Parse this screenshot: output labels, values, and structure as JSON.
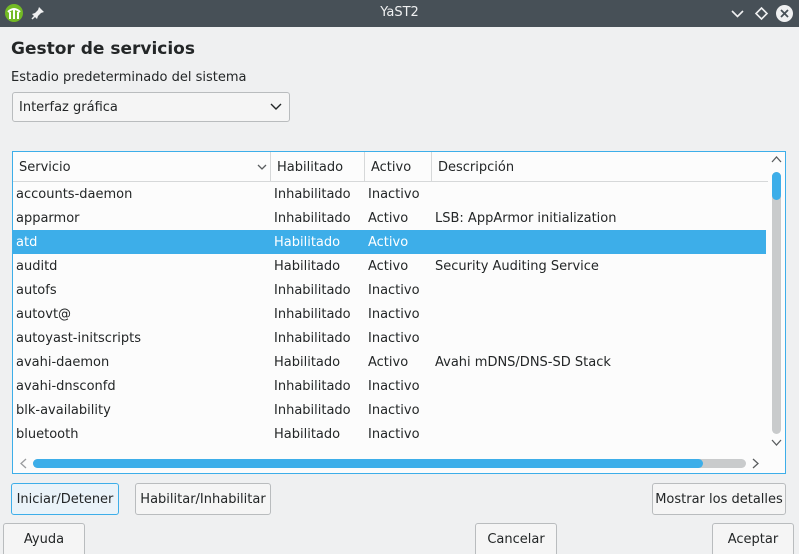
{
  "window": {
    "title": "YaST2"
  },
  "page": {
    "heading": "Gestor de servicios",
    "default_target_label": "Estadio predeterminado del sistema",
    "default_target_value": "Interfaz gráfica"
  },
  "table": {
    "columns": [
      "Servicio",
      "Habilitado",
      "Activo",
      "Descripción"
    ],
    "rows": [
      {
        "name": "accounts-daemon",
        "enabled": "Inhabilitado",
        "active": "Inactivo",
        "description": ""
      },
      {
        "name": "apparmor",
        "enabled": "Inhabilitado",
        "active": "Activo",
        "description": "LSB: AppArmor initialization"
      },
      {
        "name": "atd",
        "enabled": "Habilitado",
        "active": "Activo",
        "description": "",
        "selected": true
      },
      {
        "name": "auditd",
        "enabled": "Habilitado",
        "active": "Activo",
        "description": "Security Auditing Service"
      },
      {
        "name": "autofs",
        "enabled": "Inhabilitado",
        "active": "Inactivo",
        "description": ""
      },
      {
        "name": "autovt@",
        "enabled": "Inhabilitado",
        "active": "Inactivo",
        "description": ""
      },
      {
        "name": "autoyast-initscripts",
        "enabled": "Inhabilitado",
        "active": "Inactivo",
        "description": ""
      },
      {
        "name": "avahi-daemon",
        "enabled": "Habilitado",
        "active": "Activo",
        "description": "Avahi mDNS/DNS-SD Stack"
      },
      {
        "name": "avahi-dnsconfd",
        "enabled": "Inhabilitado",
        "active": "Inactivo",
        "description": ""
      },
      {
        "name": "blk-availability",
        "enabled": "Inhabilitado",
        "active": "Inactivo",
        "description": ""
      },
      {
        "name": "bluetooth",
        "enabled": "Habilitado",
        "active": "Inactivo",
        "description": ""
      }
    ]
  },
  "buttons": {
    "start_stop": "Iniciar/Detener",
    "enable_disable": "Habilitar/Inhabilitar",
    "show_details": "Mostrar los detalles",
    "help": "Ayuda",
    "cancel": "Cancelar",
    "accept": "Aceptar"
  },
  "colors": {
    "accent": "#3daee9",
    "titlebar": "#475057",
    "background": "#eff0f1"
  }
}
